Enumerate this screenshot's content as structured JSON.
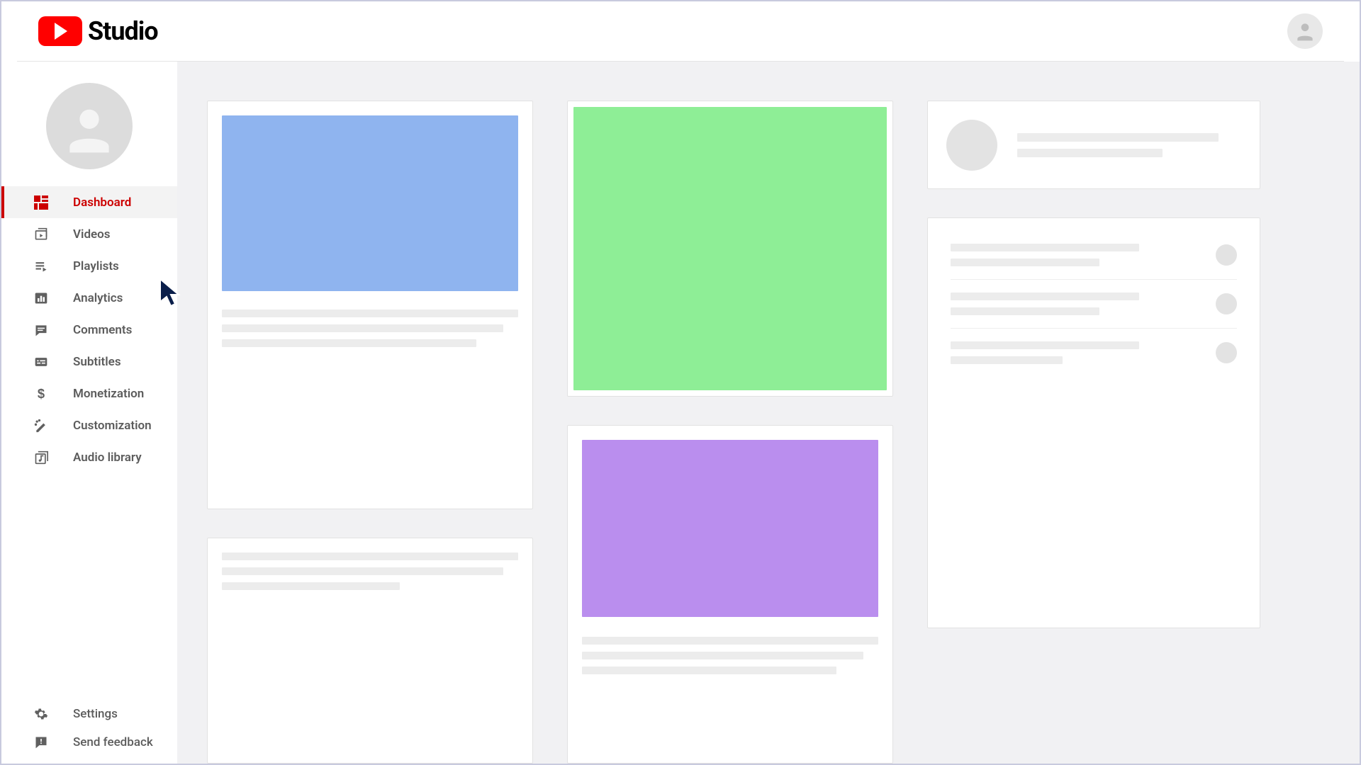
{
  "brand": {
    "name": "Studio"
  },
  "sidebar": {
    "items": [
      {
        "label": "Dashboard"
      },
      {
        "label": "Videos"
      },
      {
        "label": "Playlists"
      },
      {
        "label": "Analytics"
      },
      {
        "label": "Comments"
      },
      {
        "label": "Subtitles"
      },
      {
        "label": "Monetization"
      },
      {
        "label": "Customization"
      },
      {
        "label": "Audio library"
      }
    ],
    "footer": [
      {
        "label": "Settings"
      },
      {
        "label": "Send feedback"
      }
    ]
  },
  "colors": {
    "accent": "#cc0000",
    "thumbs": {
      "blue": "#8fb4ef",
      "green": "#8eee96",
      "purple": "#ba8eee"
    }
  }
}
